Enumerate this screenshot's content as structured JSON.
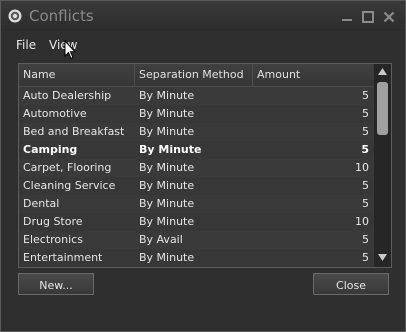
{
  "window": {
    "title": "Conflicts"
  },
  "menu": {
    "items": [
      "File",
      "View"
    ]
  },
  "columns": [
    "Name",
    "Separation Method",
    "Amount"
  ],
  "rows": [
    {
      "name": "Auto Dealership",
      "method": "By Minute",
      "amount": "5"
    },
    {
      "name": "Automotive",
      "method": "By Minute",
      "amount": "5"
    },
    {
      "name": "Bed and Breakfast",
      "method": "By Minute",
      "amount": "5"
    },
    {
      "name": "Camping",
      "method": "By Minute",
      "amount": "5",
      "selected": true
    },
    {
      "name": "Carpet, Flooring",
      "method": "By Minute",
      "amount": "10"
    },
    {
      "name": "Cleaning Service",
      "method": "By Minute",
      "amount": "5"
    },
    {
      "name": "Dental",
      "method": "By Minute",
      "amount": "5"
    },
    {
      "name": "Drug Store",
      "method": "By Minute",
      "amount": "10"
    },
    {
      "name": "Electronics",
      "method": "By Avail",
      "amount": "5"
    },
    {
      "name": "Entertainment",
      "method": "By Minute",
      "amount": "5"
    }
  ],
  "buttons": {
    "new_label": "New...",
    "close_label": "Close"
  },
  "icons": {
    "app": "gear-icon",
    "minimize": "minimize-icon",
    "maximize": "maximize-icon",
    "close": "close-icon",
    "scroll_up": "chevron-up-icon",
    "scroll_down": "chevron-down-icon"
  },
  "colors": {
    "background": "#2f2f2f",
    "list": "#3a3a3a",
    "text": "#e6e6e6"
  }
}
